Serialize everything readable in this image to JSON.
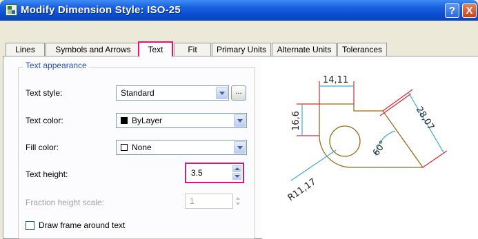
{
  "window": {
    "title": "Modify Dimension Style: ISO-25",
    "help_label": "?",
    "close_label": "X"
  },
  "tabs": [
    {
      "label": "Lines",
      "active": false
    },
    {
      "label": "Symbols and Arrows",
      "active": false
    },
    {
      "label": "Text",
      "active": true
    },
    {
      "label": "Fit",
      "active": false
    },
    {
      "label": "Primary Units",
      "active": false
    },
    {
      "label": "Alternate Units",
      "active": false
    },
    {
      "label": "Tolerances",
      "active": false
    }
  ],
  "text_appearance": {
    "group_label": "Text appearance",
    "text_style": {
      "label": "Text style:",
      "value": "Standard",
      "ellipsis": "..."
    },
    "text_color": {
      "label": "Text color:",
      "value": "ByLayer",
      "swatch": "#000000"
    },
    "fill_color": {
      "label": "Fill color:",
      "value": "None"
    },
    "text_height": {
      "label": "Text height:",
      "value": "3.5"
    },
    "fraction_height_scale": {
      "label": "Fraction height scale:",
      "value": "1"
    },
    "draw_frame": {
      "label": "Draw frame around text",
      "checked": false
    }
  },
  "preview": {
    "dim_top": "14,11",
    "dim_left": "16,6",
    "dim_right": "28,07",
    "dim_angle": "60°",
    "dim_radius": "R11,17"
  },
  "colors": {
    "highlight": "#e0157a",
    "dimension_line": "#3fa7d8",
    "extension_line": "#e8202a",
    "object_line": "#9b6a1e"
  }
}
